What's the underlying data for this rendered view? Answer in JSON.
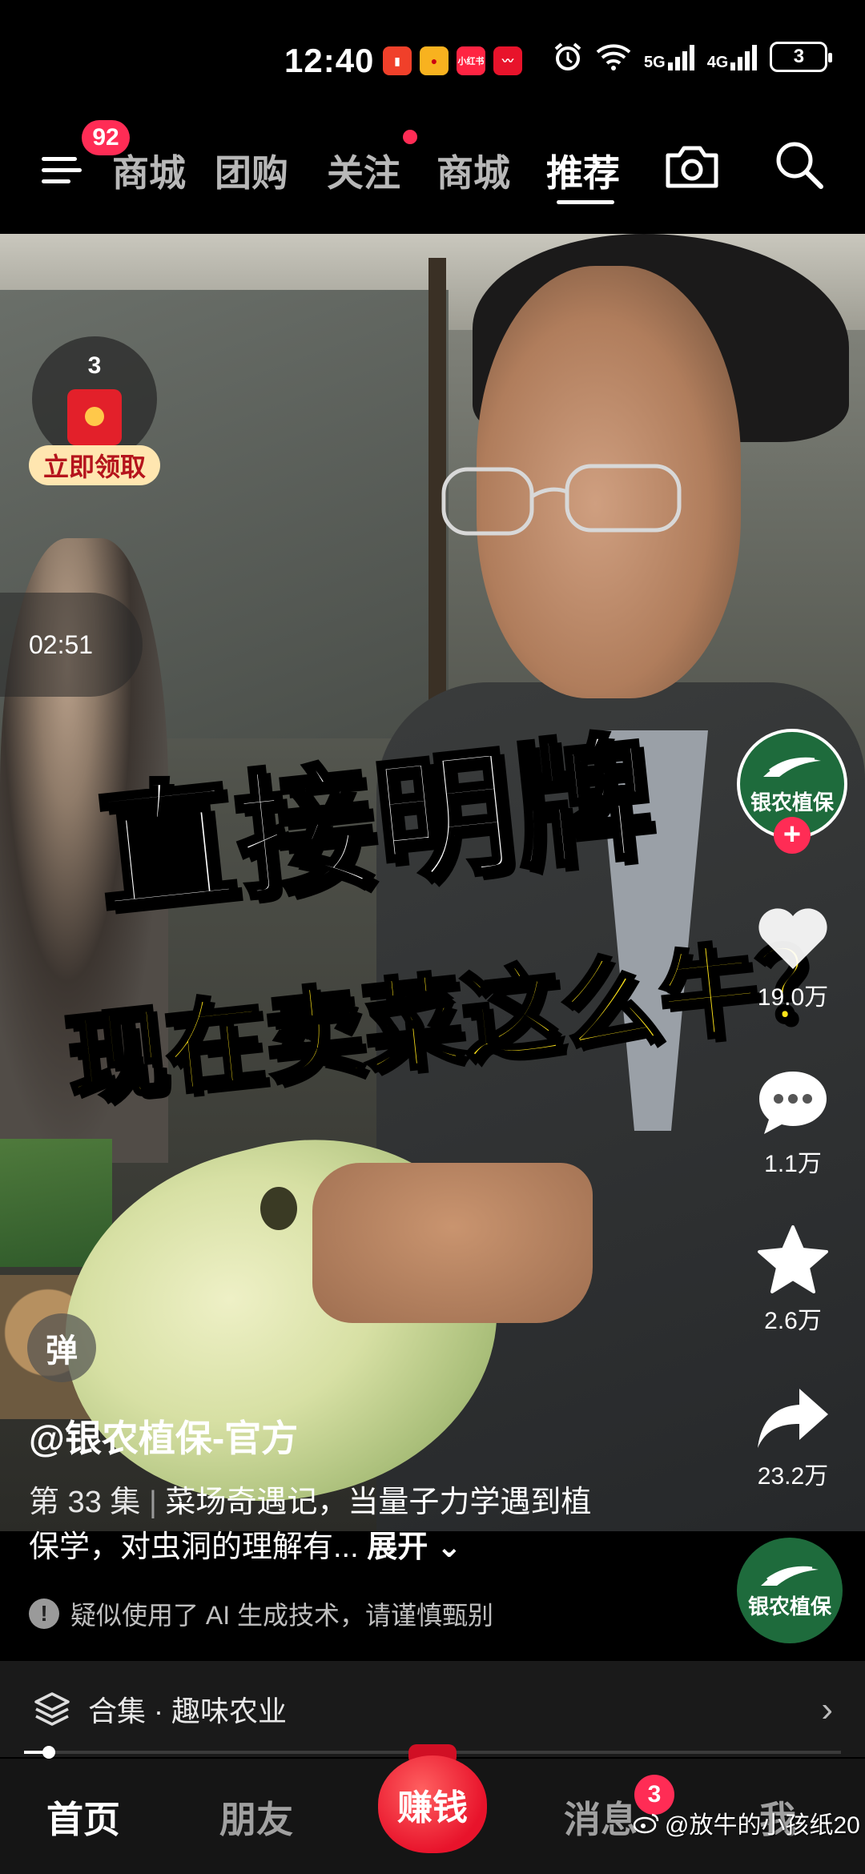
{
  "status_bar": {
    "time": "12:40",
    "apps": [
      {
        "icon": "notification-app-icon",
        "label": "",
        "color": "#f0402a"
      },
      {
        "icon": "weibo-icon",
        "label": "",
        "color": "#f8b21f"
      },
      {
        "icon": "xiaohongshu-icon",
        "label": "小红书",
        "color": "#ff2442"
      },
      {
        "icon": "app-red-icon",
        "label": "",
        "color": "#e8132b"
      }
    ],
    "network_5g": "5G",
    "network_4g": "4G",
    "battery": "3"
  },
  "top_nav": {
    "menu_badge": "92",
    "tabs": [
      {
        "label": "商城",
        "active": false
      },
      {
        "label": "团购",
        "active": false
      },
      {
        "label": "关注",
        "active": false,
        "dot": true
      },
      {
        "label": "商城",
        "active": false
      },
      {
        "label": "推荐",
        "active": true
      }
    ]
  },
  "video": {
    "headline_line1": "直接明牌",
    "headline_line2": "现在卖菜这么牛？",
    "red_packet": {
      "count": "3",
      "label": "立即领取"
    },
    "timer": "02:51",
    "author_avatar_label": "银农植保",
    "actions": {
      "likes": "19.0万",
      "comments": "1.1万",
      "favorites": "2.6万",
      "shares": "23.2万"
    },
    "danmaku_label": "弹",
    "author": "@银农植保-官方",
    "episode": "第 33 集",
    "description": "菜场奇遇记，当量子力学遇到植保学，对虫洞的理解有...",
    "expand_label": "展开",
    "ai_notice": "疑似使用了 AI 生成技术，请谨慎甄别",
    "brand_logo_label": "银农植保"
  },
  "collection": {
    "label": "合集 · 趣味农业",
    "progress": 0.03
  },
  "bottom_nav": {
    "tabs": [
      "首页",
      "朋友",
      "消息",
      "我"
    ],
    "earn_label": "赚钱",
    "message_badge": "3"
  },
  "watermark": "@放牛的小孩纸20",
  "colors": {
    "accent_red": "#ff2c55",
    "headline_yellow": "#ffe419",
    "brand_green": "#1e6b3c"
  }
}
